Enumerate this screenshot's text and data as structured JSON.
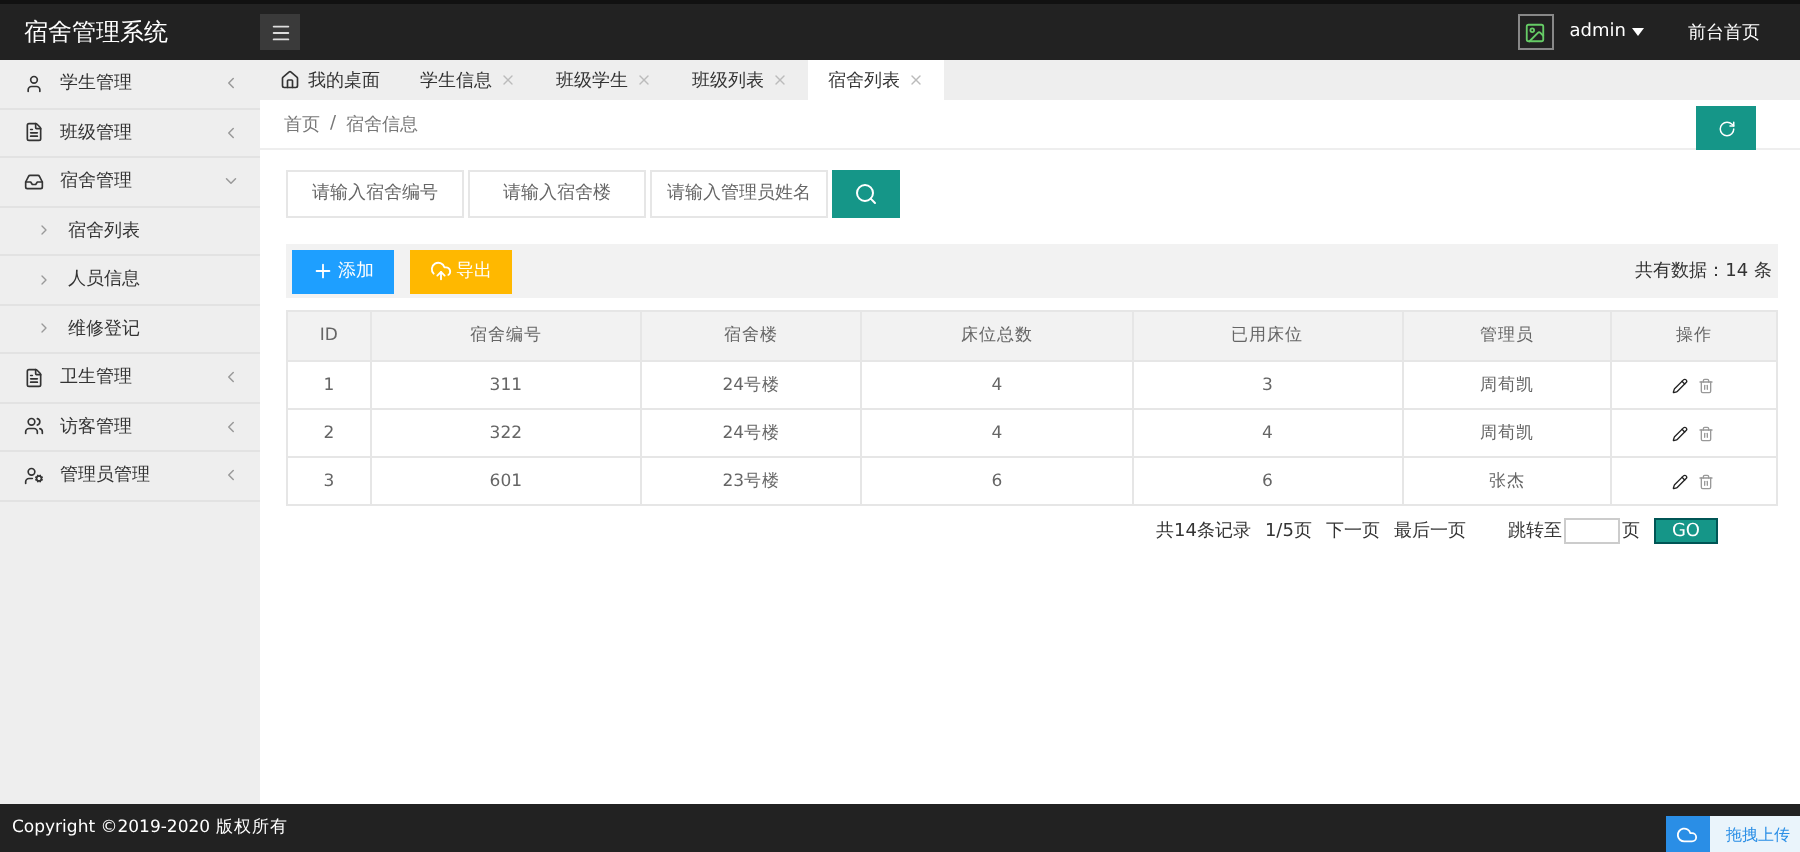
{
  "brand": "宿舍管理系统",
  "user": {
    "name": "admin"
  },
  "top_link": "前台首页",
  "sidebar": {
    "items": [
      {
        "label": "学生管理",
        "expanded": false
      },
      {
        "label": "班级管理",
        "expanded": false
      },
      {
        "label": "宿舍管理",
        "expanded": true,
        "children": [
          {
            "label": "宿舍列表"
          },
          {
            "label": "人员信息"
          },
          {
            "label": "维修登记"
          }
        ]
      },
      {
        "label": "卫生管理",
        "expanded": false
      },
      {
        "label": "访客管理",
        "expanded": false
      },
      {
        "label": "管理员管理",
        "expanded": false
      }
    ]
  },
  "tabs": [
    {
      "label": "我的桌面",
      "kind": "home",
      "selected": false
    },
    {
      "label": "学生信息",
      "kind": "page",
      "selected": false
    },
    {
      "label": "班级学生",
      "kind": "page",
      "selected": false
    },
    {
      "label": "班级列表",
      "kind": "page",
      "selected": false
    },
    {
      "label": "宿舍列表",
      "kind": "page",
      "selected": true
    }
  ],
  "breadcrumb": {
    "items": [
      "首页",
      "宿舍信息"
    ],
    "separator": "/"
  },
  "search": {
    "fields": [
      {
        "placeholder": "请输入宿舍编号"
      },
      {
        "placeholder": "请输入宿舍楼"
      },
      {
        "placeholder": "请输入管理员姓名"
      }
    ]
  },
  "toolbar": {
    "add": "添加",
    "export": "导出",
    "total": "共有数据：14 条"
  },
  "table": {
    "columns": [
      "ID",
      "宿舍编号",
      "宿舍楼",
      "床位总数",
      "已用床位",
      "管理员",
      "操作"
    ],
    "rows": [
      [
        "1",
        "311",
        "24号楼",
        "4",
        "3",
        "周荀凯"
      ],
      [
        "2",
        "322",
        "24号楼",
        "4",
        "4",
        "周荀凯"
      ],
      [
        "3",
        "601",
        "23号楼",
        "6",
        "6",
        "张杰"
      ]
    ]
  },
  "pagination": {
    "records": "共14条记录",
    "page": "1/5页",
    "next": "下一页",
    "last": "最后一页",
    "jump": "跳转至",
    "unit": "页",
    "go": "GO"
  },
  "footer": "Copyright ©2019-2020 版权所有",
  "upload_widget": "拖拽上传"
}
